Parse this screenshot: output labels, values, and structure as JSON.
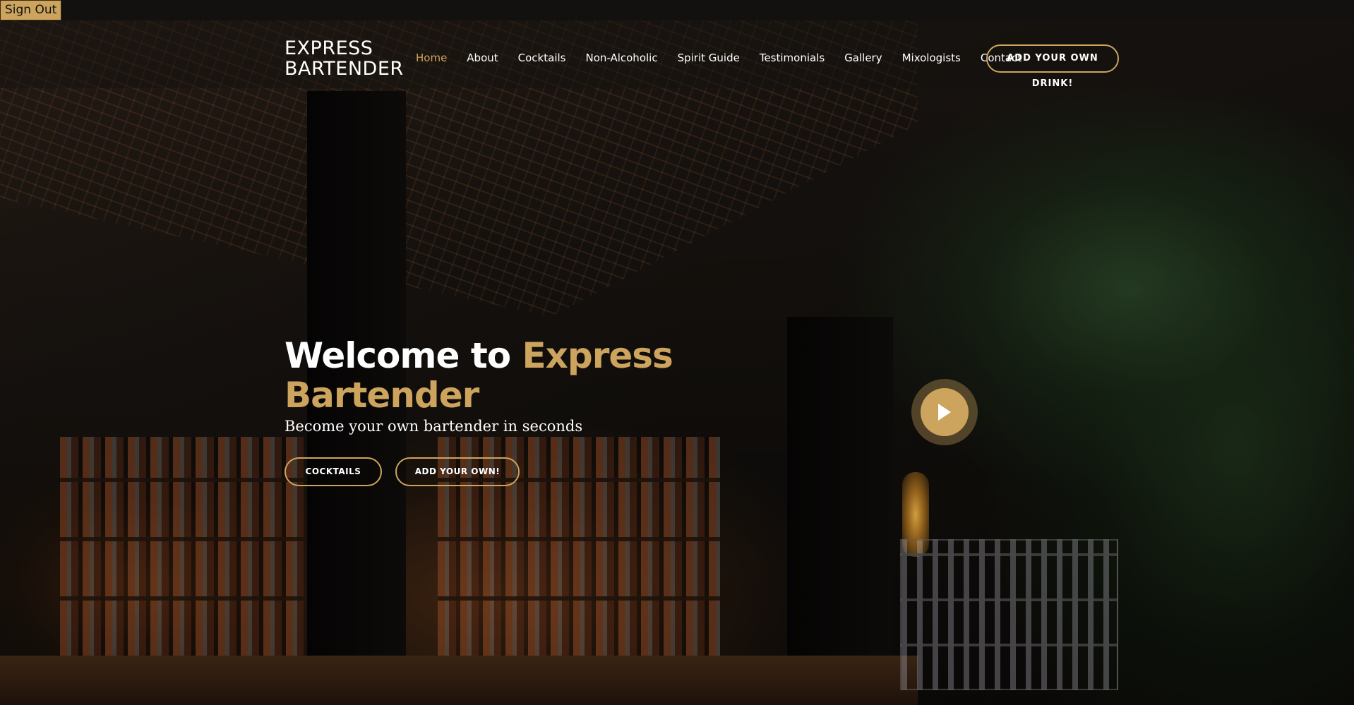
{
  "topbar": {
    "signout_label": "Sign Out"
  },
  "header": {
    "logo_line1": "EXPRESS",
    "logo_line2": "BARTENDER",
    "nav": [
      {
        "label": "Home",
        "active": true
      },
      {
        "label": "About"
      },
      {
        "label": "Cocktails"
      },
      {
        "label": "Non-Alcoholic"
      },
      {
        "label": "Spirit Guide"
      },
      {
        "label": "Testimonials"
      },
      {
        "label": "Gallery"
      },
      {
        "label": "Mixologists"
      },
      {
        "label": "Contact"
      }
    ],
    "cta_label": "ADD YOUR OWN DRINK!"
  },
  "hero": {
    "title_part1": "Welcome to ",
    "title_accent": "Express Bartender",
    "subtitle": "Become your own bartender in seconds",
    "btn_cocktails": "COCKTAILS",
    "btn_add_own": "ADD YOUR OWN!"
  },
  "icons": {
    "play": "play-icon"
  },
  "colors": {
    "accent": "#cda45e",
    "text": "#ffffff",
    "topbar": "#121110"
  }
}
